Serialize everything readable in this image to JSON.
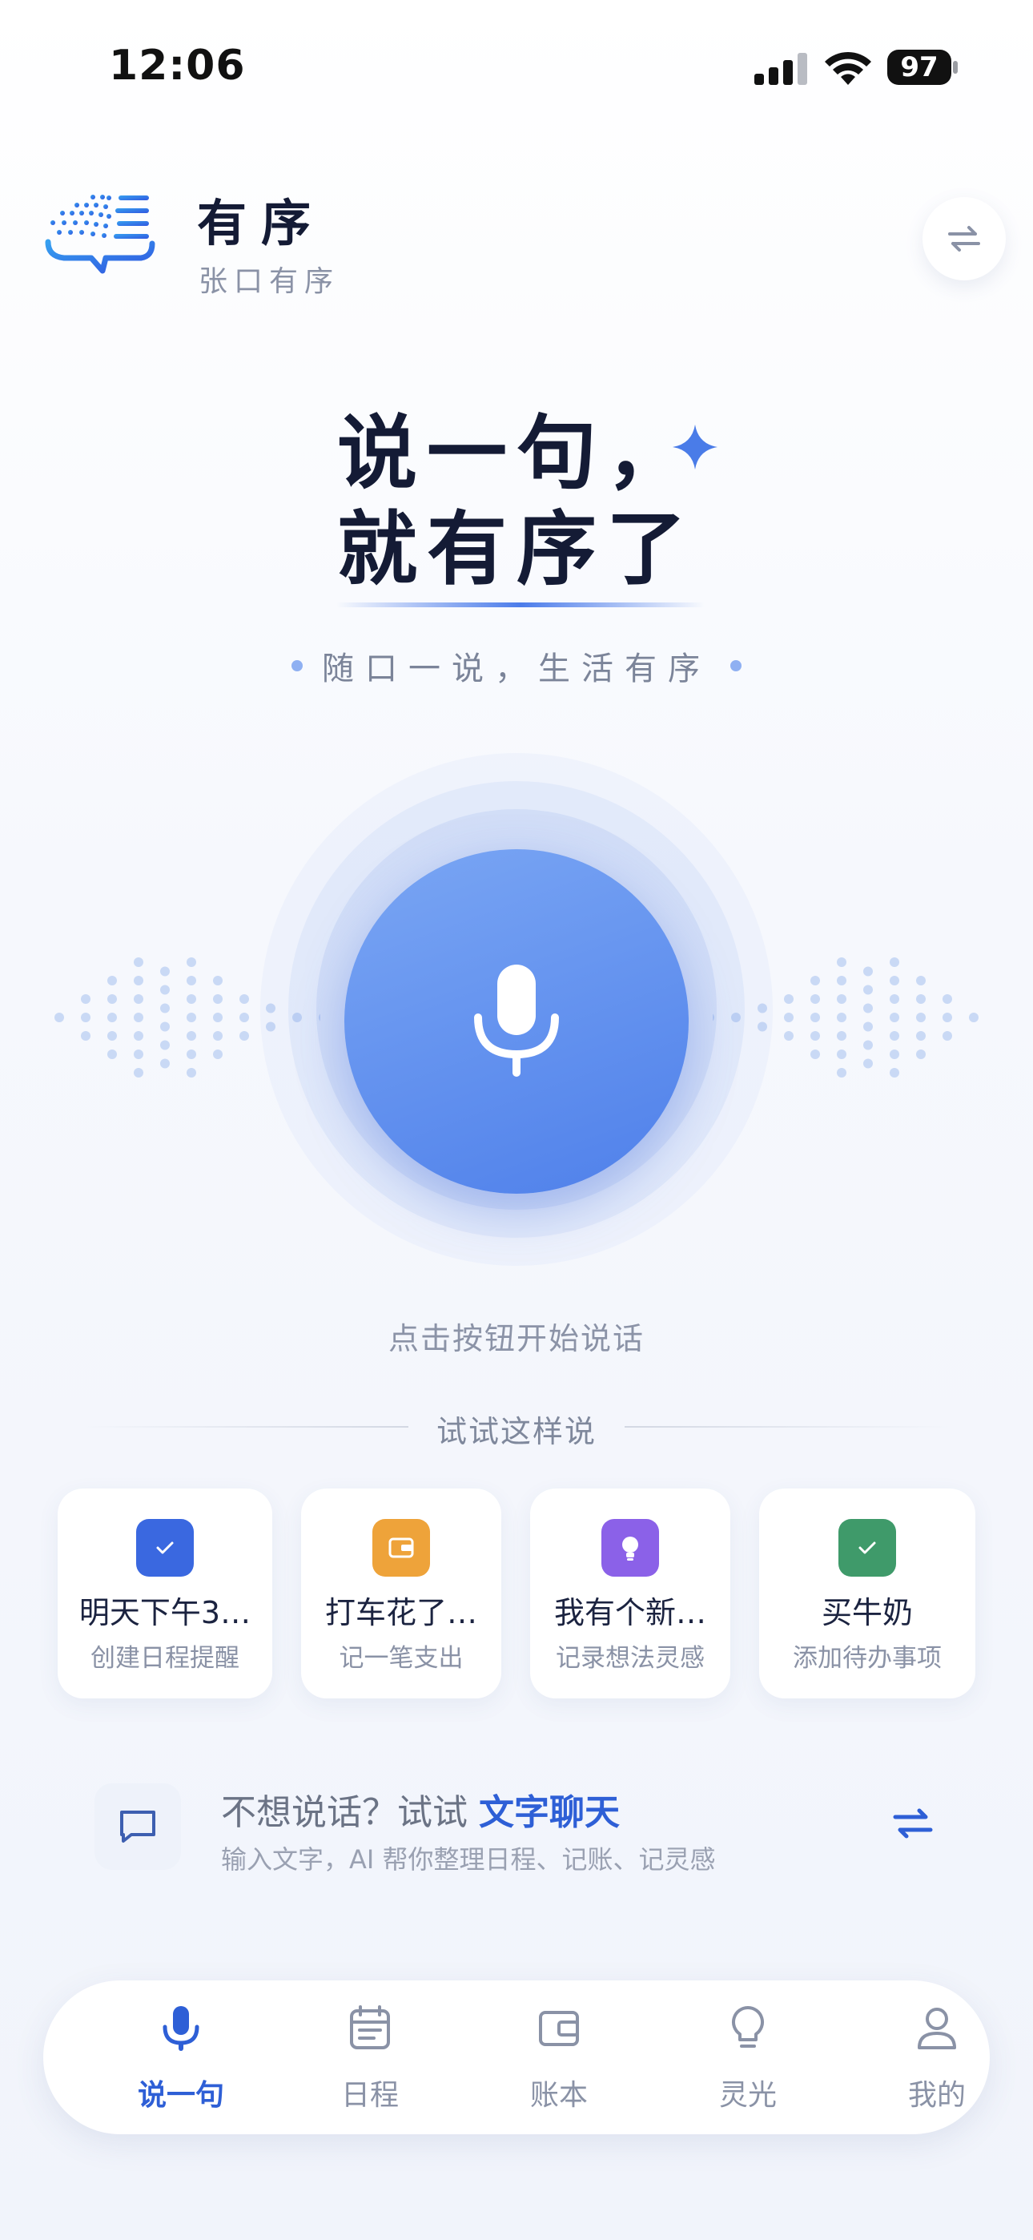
{
  "status_bar": {
    "time": "12:06",
    "battery": "97"
  },
  "header": {
    "app_name": "有序",
    "app_subtitle": "张口有序"
  },
  "hero": {
    "line1": "说一句，",
    "line2": "就有序了",
    "tagline": "随口一说，生活有序"
  },
  "mic": {
    "hint": "点击按钮开始说话"
  },
  "suggestions": {
    "title": "试试这样说",
    "items": [
      {
        "title": "明天下午3…",
        "subtitle": "创建日程提醒",
        "icon": "check-icon",
        "color": "#3a68e0"
      },
      {
        "title": "打车花了…",
        "subtitle": "记一笔支出",
        "icon": "wallet-icon",
        "color": "#eea33a"
      },
      {
        "title": "我有个新…",
        "subtitle": "记录想法灵感",
        "icon": "bulb-icon",
        "color": "#8b61e8"
      },
      {
        "title": "买牛奶",
        "subtitle": "添加待办事项",
        "icon": "check-icon",
        "color": "#3f9a6a"
      }
    ]
  },
  "text_chat": {
    "prompt": "不想说话？试试",
    "link": "文字聊天",
    "description": "输入文字，AI 帮你整理日程、记账、记灵感"
  },
  "tabs": [
    {
      "label": "说一句",
      "icon": "mic-icon",
      "active": true
    },
    {
      "label": "日程",
      "icon": "calendar-icon",
      "active": false
    },
    {
      "label": "账本",
      "icon": "wallet-icon",
      "active": false
    },
    {
      "label": "灵光",
      "icon": "bulb-icon",
      "active": false
    },
    {
      "label": "我的",
      "icon": "user-icon",
      "active": false
    }
  ],
  "colors": {
    "accent": "#2e5fd6",
    "mic": "#5f8eee"
  }
}
